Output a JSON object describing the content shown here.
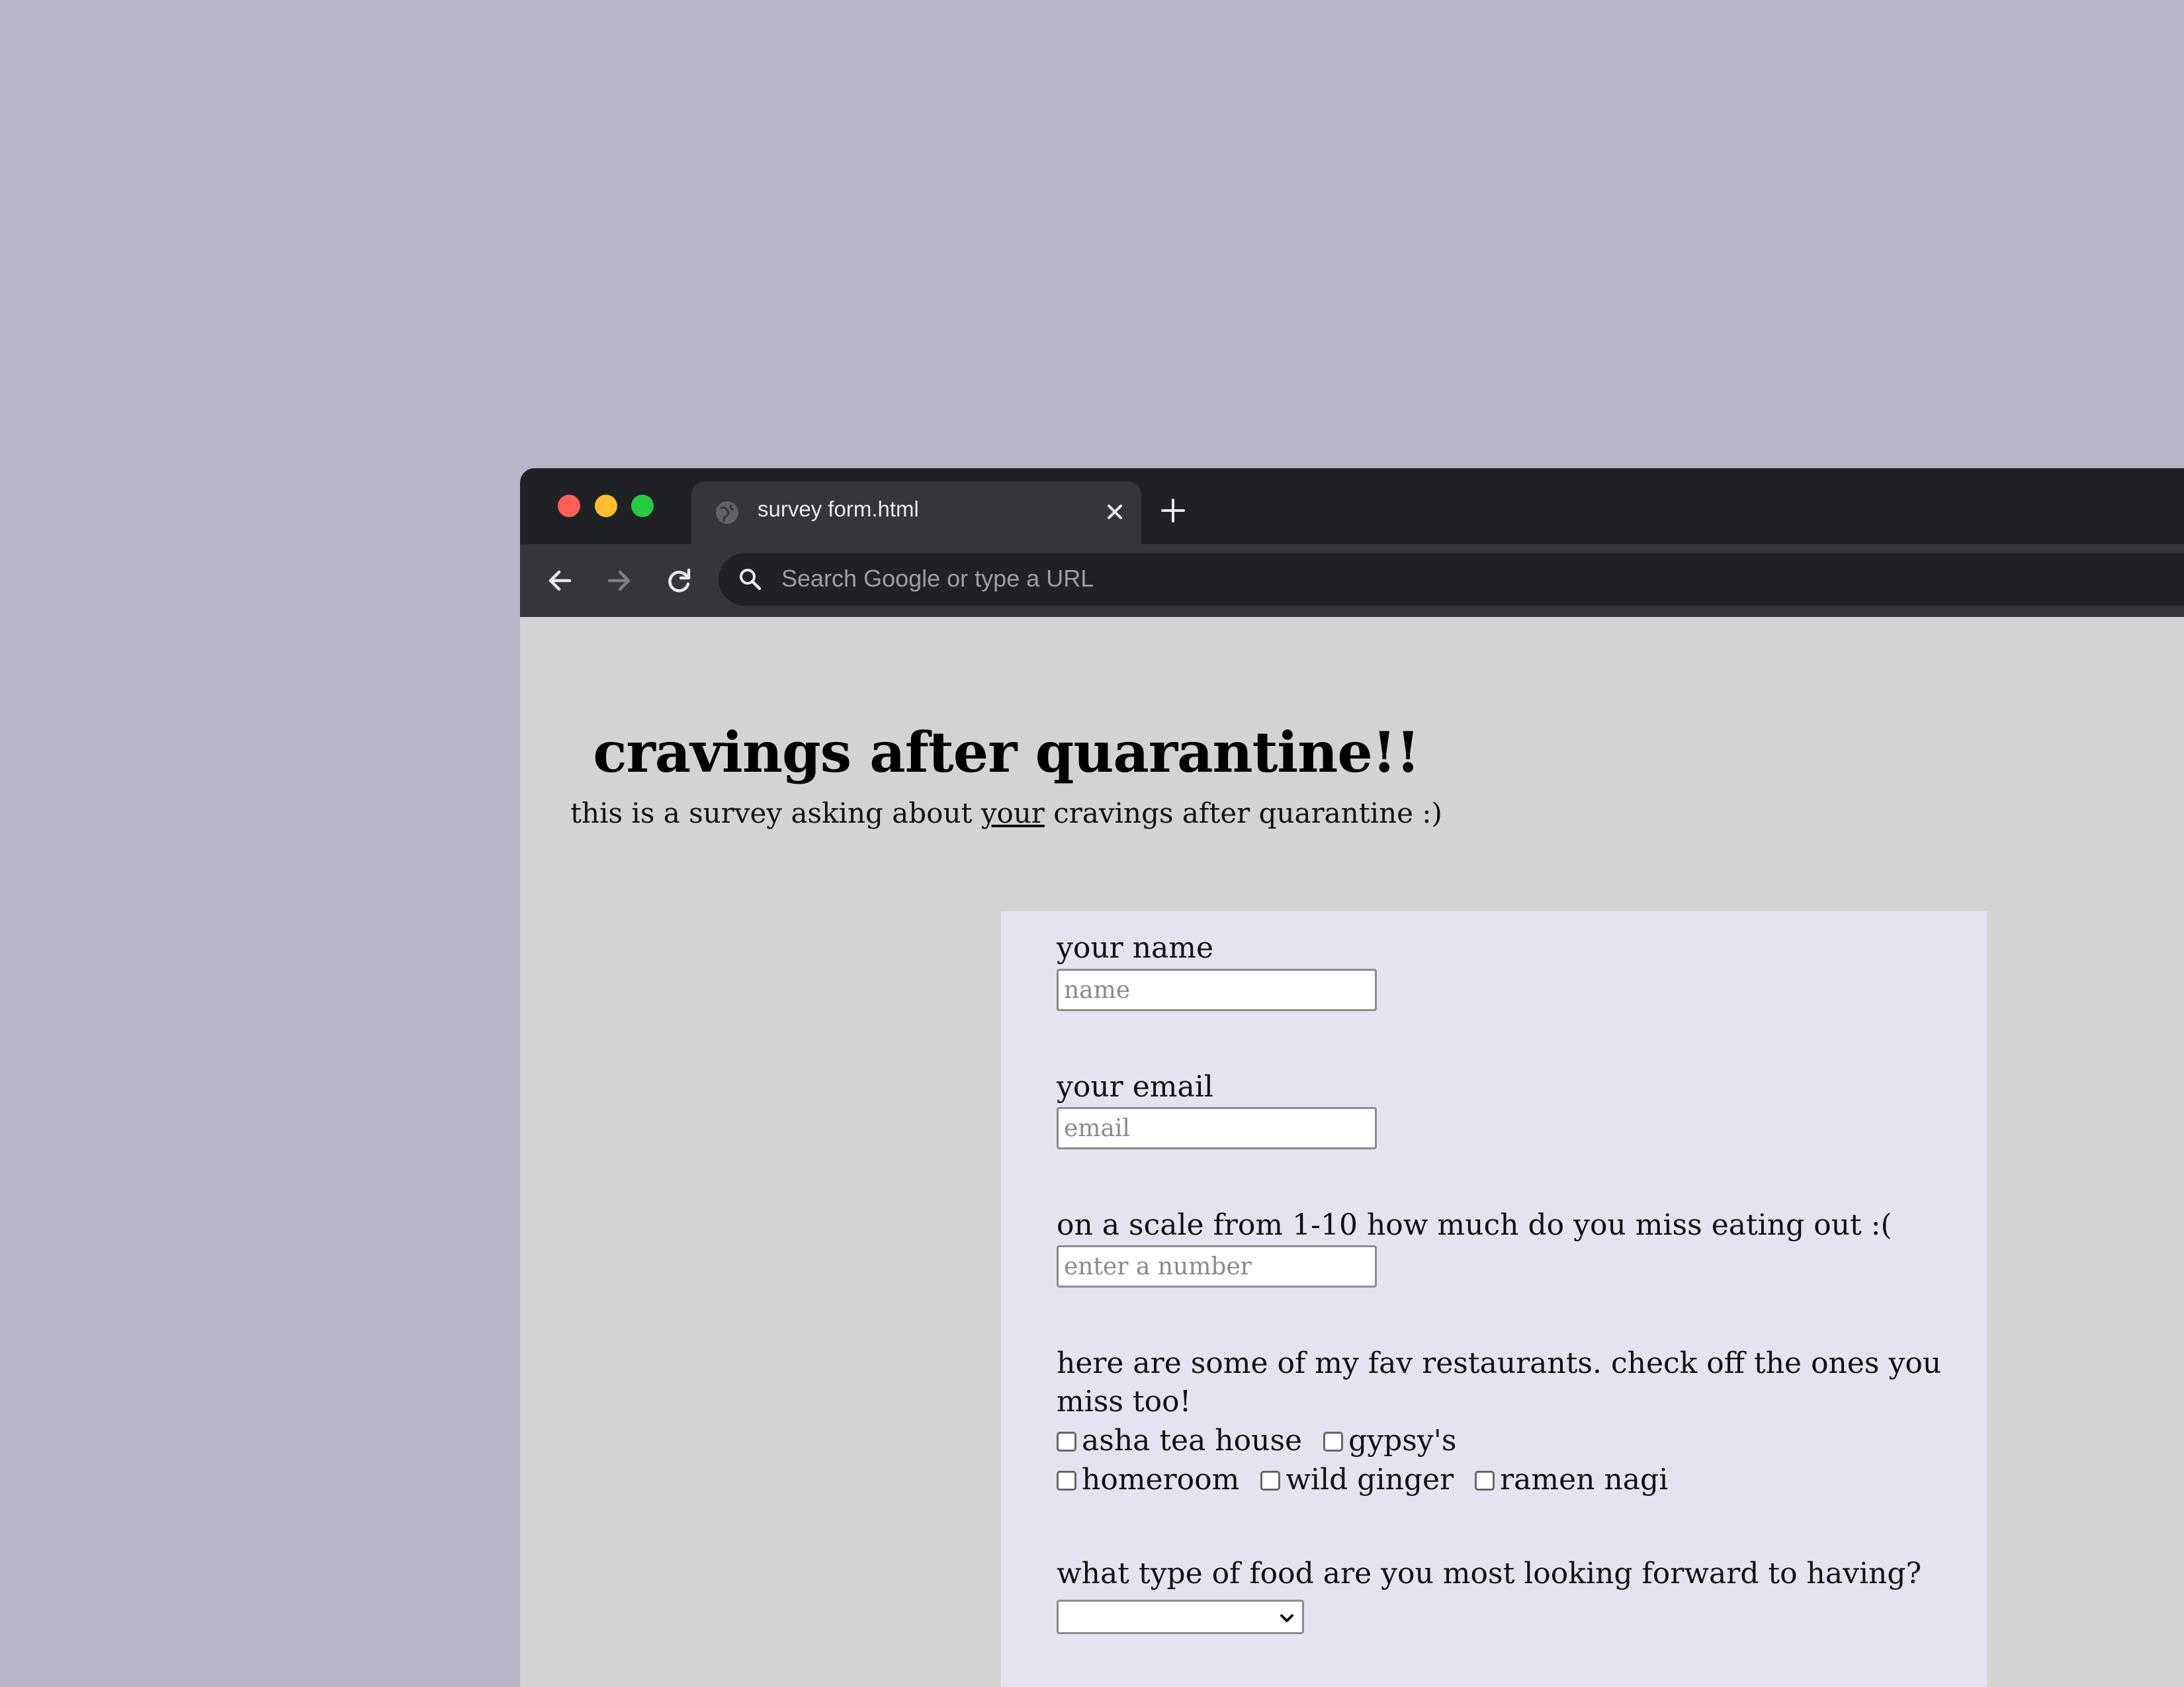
{
  "browser": {
    "tab_title": "survey form.html",
    "omnibox_placeholder": "Search Google or type a URL"
  },
  "page": {
    "title": "cravings after quarantine!!",
    "subtitle_before": "this is a survey asking about ",
    "subtitle_emphasis": "your",
    "subtitle_after": " cravings after quarantine :)"
  },
  "form": {
    "name_label": "your name",
    "name_placeholder": "name",
    "email_label": "your email",
    "email_placeholder": "email",
    "scale_label": "on a scale from 1-10 how much do you miss eating out :(",
    "scale_placeholder": "enter a number",
    "restaurants_label_line1": "here are some of my fav restaurants. check off the ones you",
    "restaurants_label_line2": "miss too!",
    "restaurants": [
      "asha tea house",
      "gypsy's",
      "homeroom",
      "wild ginger",
      "ramen nagi"
    ],
    "food_type_label": "what type of food are you most looking forward to having?",
    "food_type_selected": ""
  },
  "colors": {
    "desktop": "#b7b6c8",
    "chrome_dark": "#202124",
    "chrome_tab": "#35363a",
    "page_bg": "#d3d3d3",
    "form_bg": "#e4e3f0"
  }
}
